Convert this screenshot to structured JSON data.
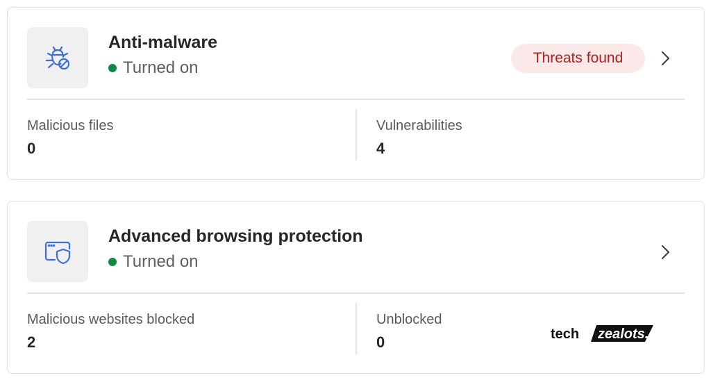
{
  "cards": {
    "antimalware": {
      "icon": "bug-blocked-icon",
      "title": "Anti-malware",
      "status": "Turned on",
      "badge": "Threats found",
      "metrics": {
        "left_label": "Malicious files",
        "left_value": "0",
        "right_label": "Vulnerabilities",
        "right_value": "4"
      }
    },
    "browsing": {
      "icon": "browser-shield-icon",
      "title": "Advanced browsing protection",
      "status": "Turned on",
      "metrics": {
        "left_label": "Malicious websites blocked",
        "left_value": "2",
        "right_label": "Unblocked",
        "right_value": "0"
      }
    }
  },
  "watermark": {
    "text_part1": "tech",
    "text_part2": "zealots."
  },
  "colors": {
    "status_on": "#0f8a3f",
    "badge_bg": "#fbe9e9",
    "badge_text": "#b01e1e",
    "icon_blue": "#3d6fd8"
  }
}
